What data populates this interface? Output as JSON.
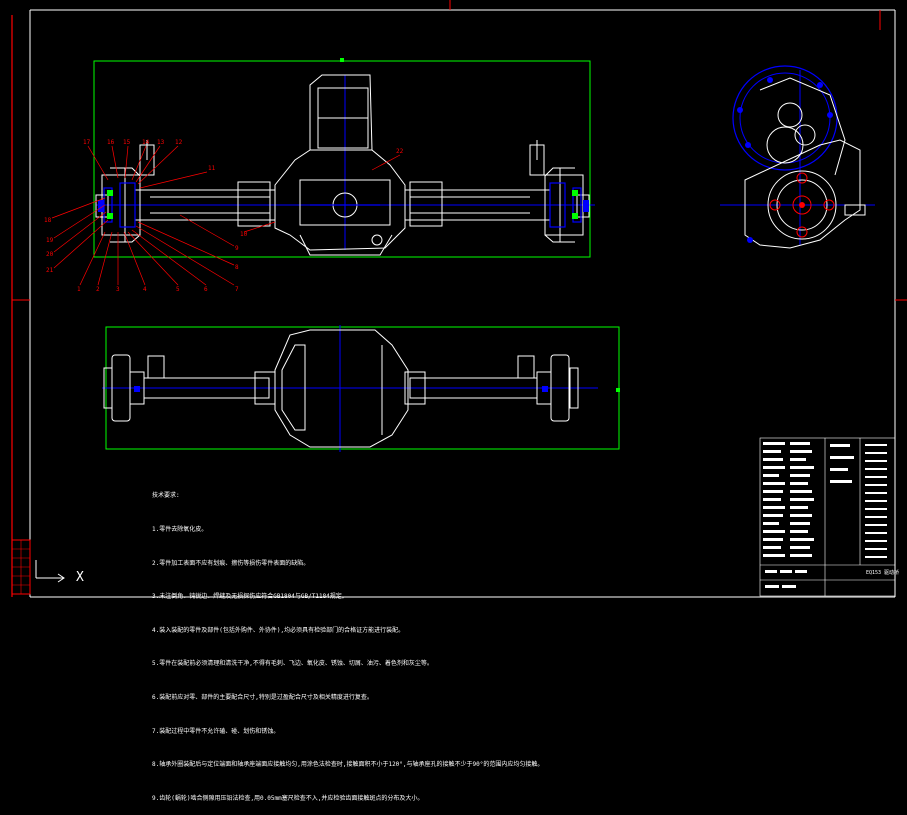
{
  "drawing": {
    "title_block_code": "EQ153 驱动桥",
    "axis_label": "X"
  },
  "balloons_top": [
    "17",
    "16",
    "15",
    "14",
    "13",
    "12",
    "11",
    "22"
  ],
  "balloons_left": [
    "18",
    "19",
    "20",
    "21"
  ],
  "balloons_bottom": [
    "1",
    "2",
    "3",
    "4",
    "5",
    "6",
    "7",
    "8",
    "9",
    "10"
  ],
  "notes": {
    "heading": "技术要求:",
    "lines": [
      "1.零件去除氧化皮。",
      "2.零件加工表面不应有划痕、擦伤等损伤零件表面的缺陷。",
      "3.未注倒角、钝锐边、焊缝及无损探伤应符合GB1804与GB/T1184规定。",
      "4.装入装配的零件及部件(包括外购件、外协件),均必须具有检验部门的合格证方能进行装配。",
      "5.零件在装配前必须清理和清洗干净,不得有毛刺、飞边、氧化皮、锈蚀、切屑、油污、着色剂和灰尘等。",
      "6.装配前应对零、部件的主要配合尺寸,特别是过盈配合尺寸及相关精度进行复查。",
      "7.装配过程中零件不允许磕、碰、划伤和锈蚀。",
      "8.轴承外圈装配后与定位端面和轴承座端面应接触均匀,用涂色法检查时,接触面积不小于120°,与轴承座孔的接触不少于90°的范围内应均匀接触。",
      "9.齿轮(蜗轮)啮合侧隙用压铅法检查,用0.05mm塞尺检查不入,并应检验齿面接触斑点的分布及大小。"
    ]
  },
  "colors": {
    "background": "#000000",
    "frame": "#ffffff",
    "border_accent": "#ff0000",
    "part_outline": "#ffffff",
    "centerline": "#0000ff",
    "viewport": "#00ff00",
    "balloon": "#ff0000",
    "part_fill": "#0000ff"
  }
}
